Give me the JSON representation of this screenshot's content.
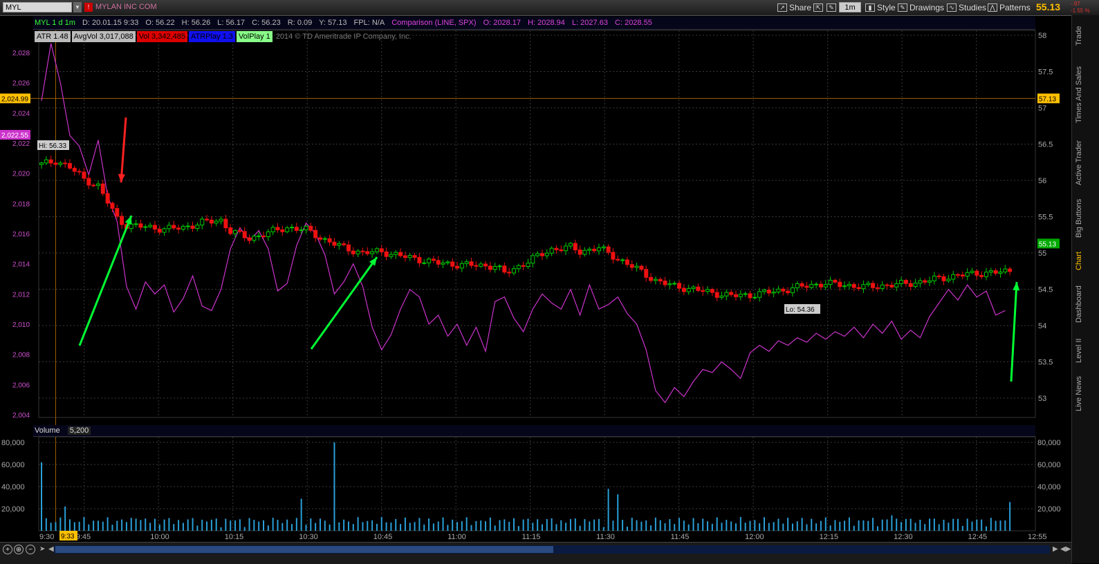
{
  "toolbar": {
    "symbol": "MYL",
    "company": "MYLAN INC COM",
    "share_label": "Share",
    "timeframe": "1m",
    "style_label": "Style",
    "drawings_label": "Drawings",
    "studies_label": "Studies",
    "patterns_label": "Patterns",
    "last_price": "55.13",
    "change_top": "-.97",
    "change_bottom": "-1.55 %"
  },
  "info": {
    "chart_id": "MYL 1 d 1m",
    "date": "D: 20.01.15 9:33",
    "open": "O: 56.22",
    "high": "H: 56.26",
    "low": "L: 56.17",
    "close": "C: 56.23",
    "range": "R: 0.09",
    "y": "Y: 57.13",
    "fpl": "FPL: N/A",
    "comparison": "Comparison (LINE, SPX)",
    "cmp_open": "O: 2028.17",
    "cmp_high": "H: 2028.94",
    "cmp_low": "L: 2027.63",
    "cmp_close": "C: 2028.55"
  },
  "studies": {
    "atr": "ATR 1.48",
    "avgvol": "AvgVol 3,017,088",
    "vol": "Vol 3,342,485",
    "atrplay": "ATRPlay 1.3",
    "volplay": "VolPlay 1",
    "copyright": "2014 © TD Ameritrade IP Company, Inc."
  },
  "volume_pane": {
    "label": "Volume",
    "value": "5,200"
  },
  "sidebar_tabs": [
    "Trade",
    "Times And Sales",
    "Active Trader",
    "Big Buttons",
    "Chart",
    "Dashboard",
    "Level II",
    "Live News"
  ],
  "active_tab": "Chart",
  "colors": {
    "up": "#00cc00",
    "down": "#ee1111",
    "comparison": "#cc33cc",
    "volume": "#2a9fd8",
    "price_tag": "#ffc000",
    "arrow_green": "#00ff33",
    "arrow_red": "#ff2020"
  },
  "chart_data": {
    "type": "candlestick",
    "title": "MYL 1 d 1m",
    "x_tick_labels": [
      "9:30",
      "9:45",
      "10:00",
      "10:15",
      "10:30",
      "10:45",
      "11:00",
      "11:15",
      "11:30",
      "11:45",
      "12:00",
      "12:15",
      "12:30",
      "12:45",
      "12:55"
    ],
    "cursor_time_label": "9:33",
    "right_axis": {
      "ticks": [
        "58",
        "57.5",
        "57",
        "56.5",
        "56",
        "55.5",
        "55",
        "54.5",
        "54",
        "53.5",
        "53"
      ],
      "ylim": [
        52.8,
        58.1
      ]
    },
    "left_axis": {
      "ticks": [
        "2,028",
        "2,026",
        "2,024",
        "2,022",
        "2,020",
        "2,018",
        "2,016",
        "2,014",
        "2,012",
        "2,010",
        "2,008",
        "2,006",
        "2,004"
      ],
      "ylim": [
        2003.8,
        2029.0
      ]
    },
    "markers": {
      "hi_label": "Hi: 56.33",
      "lo_label": "Lo: 54.36",
      "prev_close_right": "57.13",
      "prev_close_left": "2,024.99",
      "cmp_last_left": "2,022.55",
      "last_right": "55.13"
    },
    "price_close_path": [
      [
        0,
        56.22
      ],
      [
        3,
        56.27
      ],
      [
        6,
        56.18
      ],
      [
        9,
        56.02
      ],
      [
        12,
        55.92
      ],
      [
        14,
        55.7
      ],
      [
        16,
        55.48
      ],
      [
        18,
        55.38
      ],
      [
        22,
        55.36
      ],
      [
        26,
        55.33
      ],
      [
        30,
        55.35
      ],
      [
        34,
        55.42
      ],
      [
        38,
        55.45
      ],
      [
        40,
        55.3
      ],
      [
        44,
        55.2
      ],
      [
        48,
        55.28
      ],
      [
        52,
        55.35
      ],
      [
        56,
        55.32
      ],
      [
        60,
        55.18
      ],
      [
        64,
        55.07
      ],
      [
        68,
        55.0
      ],
      [
        72,
        55.02
      ],
      [
        76,
        54.96
      ],
      [
        80,
        54.91
      ],
      [
        84,
        54.86
      ],
      [
        88,
        54.84
      ],
      [
        92,
        54.83
      ],
      [
        96,
        54.82
      ],
      [
        98,
        54.72
      ],
      [
        100,
        54.78
      ],
      [
        104,
        54.92
      ],
      [
        108,
        55.05
      ],
      [
        112,
        55.08
      ],
      [
        114,
        55.02
      ],
      [
        118,
        55.07
      ],
      [
        122,
        54.92
      ],
      [
        126,
        54.78
      ],
      [
        130,
        54.62
      ],
      [
        134,
        54.54
      ],
      [
        138,
        54.5
      ],
      [
        142,
        54.45
      ],
      [
        146,
        54.41
      ],
      [
        150,
        54.42
      ],
      [
        154,
        54.46
      ],
      [
        158,
        54.5
      ],
      [
        162,
        54.55
      ],
      [
        166,
        54.58
      ],
      [
        170,
        54.56
      ],
      [
        174,
        54.53
      ],
      [
        178,
        54.55
      ],
      [
        182,
        54.57
      ],
      [
        186,
        54.6
      ],
      [
        190,
        54.65
      ],
      [
        194,
        54.69
      ],
      [
        198,
        54.72
      ],
      [
        202,
        54.73
      ],
      [
        205,
        54.75
      ]
    ],
    "comparison_series": [
      [
        0,
        2024.8
      ],
      [
        2,
        2028.6
      ],
      [
        4,
        2026.0
      ],
      [
        6,
        2022.5
      ],
      [
        8,
        2021.8
      ],
      [
        10,
        2019.9
      ],
      [
        12,
        2022.2
      ],
      [
        14,
        2018.5
      ],
      [
        16,
        2016.8
      ],
      [
        18,
        2012.5
      ],
      [
        20,
        2011.0
      ],
      [
        22,
        2012.8
      ],
      [
        24,
        2012.0
      ],
      [
        26,
        2012.6
      ],
      [
        28,
        2010.8
      ],
      [
        30,
        2011.7
      ],
      [
        32,
        2013.2
      ],
      [
        34,
        2011.2
      ],
      [
        36,
        2010.9
      ],
      [
        38,
        2012.3
      ],
      [
        40,
        2015.0
      ],
      [
        42,
        2016.4
      ],
      [
        44,
        2015.5
      ],
      [
        46,
        2016.2
      ],
      [
        48,
        2015.0
      ],
      [
        50,
        2012.2
      ],
      [
        52,
        2012.7
      ],
      [
        54,
        2015.2
      ],
      [
        56,
        2016.7
      ],
      [
        58,
        2016.0
      ],
      [
        60,
        2014.6
      ],
      [
        62,
        2012.0
      ],
      [
        64,
        2012.8
      ],
      [
        66,
        2014.0
      ],
      [
        68,
        2012.5
      ],
      [
        70,
        2009.8
      ],
      [
        72,
        2008.3
      ],
      [
        74,
        2009.3
      ],
      [
        76,
        2011.0
      ],
      [
        78,
        2012.3
      ],
      [
        80,
        2011.8
      ],
      [
        82,
        2010.0
      ],
      [
        84,
        2010.6
      ],
      [
        86,
        2009.2
      ],
      [
        88,
        2010.0
      ],
      [
        90,
        2008.6
      ],
      [
        92,
        2009.8
      ],
      [
        94,
        2008.2
      ],
      [
        96,
        2011.5
      ],
      [
        98,
        2011.8
      ],
      [
        100,
        2010.4
      ],
      [
        102,
        2009.5
      ],
      [
        104,
        2011.0
      ],
      [
        106,
        2012.0
      ],
      [
        108,
        2011.4
      ],
      [
        110,
        2011.0
      ],
      [
        112,
        2012.3
      ],
      [
        114,
        2010.6
      ],
      [
        116,
        2012.6
      ],
      [
        118,
        2011.0
      ],
      [
        120,
        2011.3
      ],
      [
        122,
        2011.8
      ],
      [
        124,
        2010.7
      ],
      [
        126,
        2010.0
      ],
      [
        128,
        2008.3
      ],
      [
        130,
        2005.6
      ],
      [
        132,
        2004.8
      ],
      [
        134,
        2005.8
      ],
      [
        136,
        2005.2
      ],
      [
        138,
        2006.2
      ],
      [
        140,
        2007.0
      ],
      [
        142,
        2006.8
      ],
      [
        144,
        2007.5
      ],
      [
        146,
        2007.0
      ],
      [
        148,
        2006.4
      ],
      [
        150,
        2008.1
      ],
      [
        152,
        2008.6
      ],
      [
        154,
        2008.2
      ],
      [
        156,
        2008.9
      ],
      [
        158,
        2008.6
      ],
      [
        160,
        2009.1
      ],
      [
        162,
        2008.8
      ],
      [
        164,
        2009.4
      ],
      [
        166,
        2009.0
      ],
      [
        168,
        2009.5
      ],
      [
        170,
        2009.2
      ],
      [
        172,
        2009.8
      ],
      [
        174,
        2009.1
      ],
      [
        176,
        2010.0
      ],
      [
        178,
        2009.4
      ],
      [
        180,
        2010.2
      ],
      [
        182,
        2009.0
      ],
      [
        184,
        2009.6
      ],
      [
        186,
        2009.1
      ],
      [
        188,
        2010.5
      ],
      [
        190,
        2011.4
      ],
      [
        192,
        2012.3
      ],
      [
        194,
        2011.6
      ],
      [
        196,
        2012.6
      ],
      [
        198,
        2011.8
      ],
      [
        200,
        2012.2
      ],
      [
        202,
        2010.6
      ],
      [
        204,
        2010.9
      ]
    ],
    "volume_ylim": [
      0,
      85000
    ],
    "volume_ticks": [
      "80,000",
      "60,000",
      "40,000",
      "20,000"
    ],
    "volume_spikes": [
      [
        0,
        62000
      ],
      [
        5,
        22000
      ],
      [
        20,
        11000
      ],
      [
        55,
        29000
      ],
      [
        62,
        80000
      ],
      [
        120,
        38000
      ],
      [
        122,
        33000
      ],
      [
        150,
        9000
      ],
      [
        180,
        14000
      ],
      [
        182,
        8000
      ],
      [
        205,
        26000
      ]
    ]
  }
}
